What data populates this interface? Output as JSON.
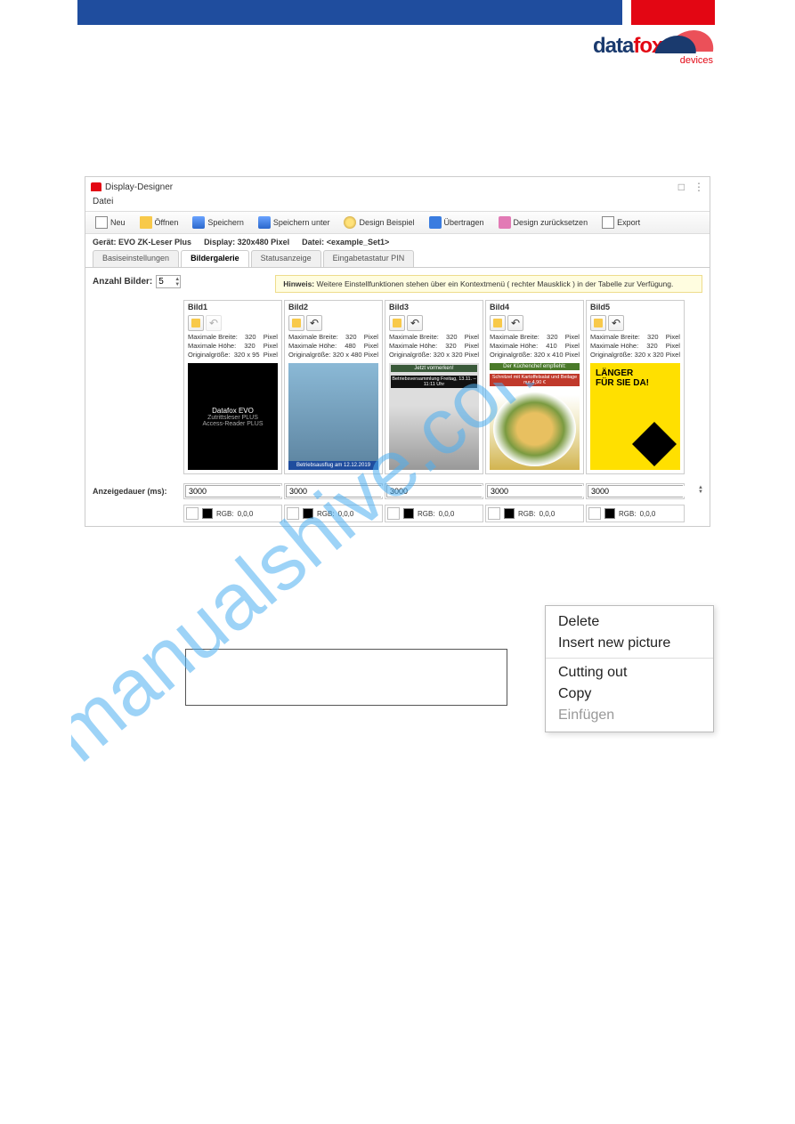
{
  "header": {
    "logo_main": "datafox:",
    "logo_sub": "devices"
  },
  "window": {
    "title": "Display-Designer",
    "menu": "Datei",
    "toolbar": {
      "neu": "Neu",
      "offnen": "Öffnen",
      "speichern": "Speichern",
      "speichern_unter": "Speichern unter",
      "beispiel": "Design Beispiel",
      "ubertragen": "Übertragen",
      "zuruck": "Design zurücksetzen",
      "export": "Export"
    },
    "info": {
      "gerat_label": "Gerät:",
      "gerat": "EVO ZK-Leser Plus",
      "display_label": "Display:",
      "display": "320x480  Pixel",
      "datei_label": "Datei:",
      "datei": "<example_Set1>"
    },
    "tabs": {
      "t1": "Basiseinstellungen",
      "t2": "Bildergalerie",
      "t3": "Statusanzeige",
      "t4": "Eingabetastatur PIN"
    },
    "count_label": "Anzahl Bilder:",
    "count_value": "5",
    "hint_label": "Hinweis:",
    "hint_text": "Weitere Einstellfunktionen stehen über ein Kontextmenü ( rechter Mausklick ) in der Tabelle zur Verfügung.",
    "images": [
      {
        "title": "Bild1",
        "mb": "320",
        "mh": "320",
        "og": "320 x 95",
        "t1": "Datafox EVO",
        "t2": "Zutrittsleser PLUS",
        "t3": "Access-Reader PLUS"
      },
      {
        "title": "Bild2",
        "mb": "320",
        "mh": "480",
        "og": "320 x 480",
        "banner": "Betriebsausflug am 12.12.2019"
      },
      {
        "title": "Bild3",
        "mb": "320",
        "mh": "320",
        "og": "320 x 320",
        "top": "Jetzt vormerken!",
        "sub": "Betriebsversammlung Freitag, 13.11. – 11:11 Uhr"
      },
      {
        "title": "Bild4",
        "mb": "320",
        "mh": "410",
        "og": "320 x 410",
        "green": "Der Küchenchef empfiehlt:",
        "red": "Schnitzel mit Kartoffelsalat und Beilage      nur 4,90 €"
      },
      {
        "title": "Bild5",
        "mb": "320",
        "mh": "320",
        "og": "320 x 320",
        "big": "LÄNGER\nFÜR SIE DA!"
      }
    ],
    "meta_labels": {
      "mb": "Maximale Breite:",
      "mh": "Maximale Höhe:",
      "og": "Originalgröße:",
      "px": "Pixel"
    },
    "duration_label": "Anzeigedauer (ms):",
    "duration_value": "3000",
    "rgb_label": "RGB:",
    "rgb_value": "0,0,0"
  },
  "ctx": {
    "delete": "Delete",
    "insert": "Insert new picture",
    "cut": "Cutting out",
    "copy": "Copy",
    "paste": "Einfügen"
  },
  "watermark": "manualshive.com"
}
